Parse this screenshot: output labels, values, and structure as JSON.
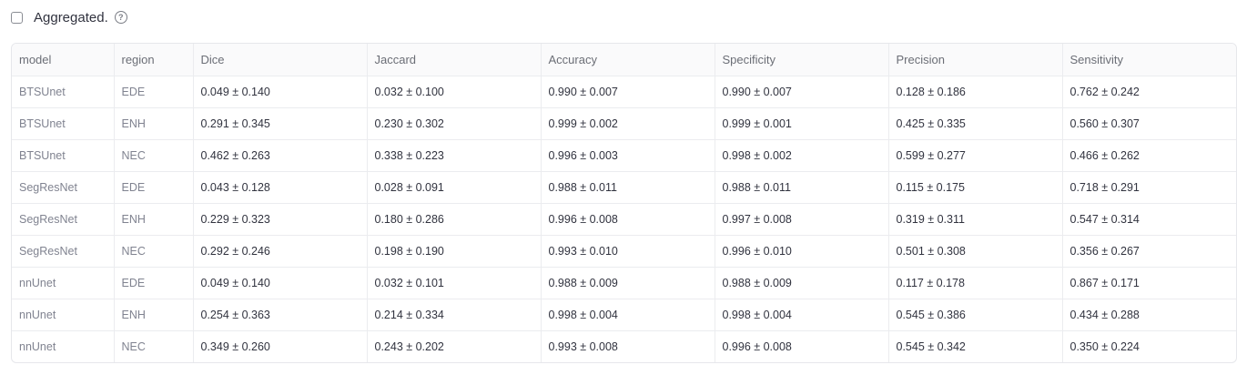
{
  "aggregated": {
    "label": "Aggregated.",
    "checked": false,
    "help_icon": "question-circle-icon"
  },
  "table": {
    "columns": [
      {
        "key": "model",
        "label": "model"
      },
      {
        "key": "region",
        "label": "region"
      },
      {
        "key": "dice",
        "label": "Dice"
      },
      {
        "key": "jaccard",
        "label": "Jaccard"
      },
      {
        "key": "accuracy",
        "label": "Accuracy"
      },
      {
        "key": "specificity",
        "label": "Specificity"
      },
      {
        "key": "precision",
        "label": "Precision"
      },
      {
        "key": "sensitivity",
        "label": "Sensitivity"
      }
    ],
    "rows": [
      {
        "model": "BTSUnet",
        "region": "EDE",
        "dice": "0.049 ± 0.140",
        "jaccard": "0.032 ± 0.100",
        "accuracy": "0.990 ± 0.007",
        "specificity": "0.990 ± 0.007",
        "precision": "0.128 ± 0.186",
        "sensitivity": "0.762 ± 0.242"
      },
      {
        "model": "BTSUnet",
        "region": "ENH",
        "dice": "0.291 ± 0.345",
        "jaccard": "0.230 ± 0.302",
        "accuracy": "0.999 ± 0.002",
        "specificity": "0.999 ± 0.001",
        "precision": "0.425 ± 0.335",
        "sensitivity": "0.560 ± 0.307"
      },
      {
        "model": "BTSUnet",
        "region": "NEC",
        "dice": "0.462 ± 0.263",
        "jaccard": "0.338 ± 0.223",
        "accuracy": "0.996 ± 0.003",
        "specificity": "0.998 ± 0.002",
        "precision": "0.599 ± 0.277",
        "sensitivity": "0.466 ± 0.262"
      },
      {
        "model": "SegResNet",
        "region": "EDE",
        "dice": "0.043 ± 0.128",
        "jaccard": "0.028 ± 0.091",
        "accuracy": "0.988 ± 0.011",
        "specificity": "0.988 ± 0.011",
        "precision": "0.115 ± 0.175",
        "sensitivity": "0.718 ± 0.291"
      },
      {
        "model": "SegResNet",
        "region": "ENH",
        "dice": "0.229 ± 0.323",
        "jaccard": "0.180 ± 0.286",
        "accuracy": "0.996 ± 0.008",
        "specificity": "0.997 ± 0.008",
        "precision": "0.319 ± 0.311",
        "sensitivity": "0.547 ± 0.314"
      },
      {
        "model": "SegResNet",
        "region": "NEC",
        "dice": "0.292 ± 0.246",
        "jaccard": "0.198 ± 0.190",
        "accuracy": "0.993 ± 0.010",
        "specificity": "0.996 ± 0.010",
        "precision": "0.501 ± 0.308",
        "sensitivity": "0.356 ± 0.267"
      },
      {
        "model": "nnUnet",
        "region": "EDE",
        "dice": "0.049 ± 0.140",
        "jaccard": "0.032 ± 0.101",
        "accuracy": "0.988 ± 0.009",
        "specificity": "0.988 ± 0.009",
        "precision": "0.117 ± 0.178",
        "sensitivity": "0.867 ± 0.171"
      },
      {
        "model": "nnUnet",
        "region": "ENH",
        "dice": "0.254 ± 0.363",
        "jaccard": "0.214 ± 0.334",
        "accuracy": "0.998 ± 0.004",
        "specificity": "0.998 ± 0.004",
        "precision": "0.545 ± 0.386",
        "sensitivity": "0.434 ± 0.288"
      },
      {
        "model": "nnUnet",
        "region": "NEC",
        "dice": "0.349 ± 0.260",
        "jaccard": "0.243 ± 0.202",
        "accuracy": "0.993 ± 0.008",
        "specificity": "0.996 ± 0.008",
        "precision": "0.545 ± 0.342",
        "sensitivity": "0.350 ± 0.224"
      }
    ]
  }
}
